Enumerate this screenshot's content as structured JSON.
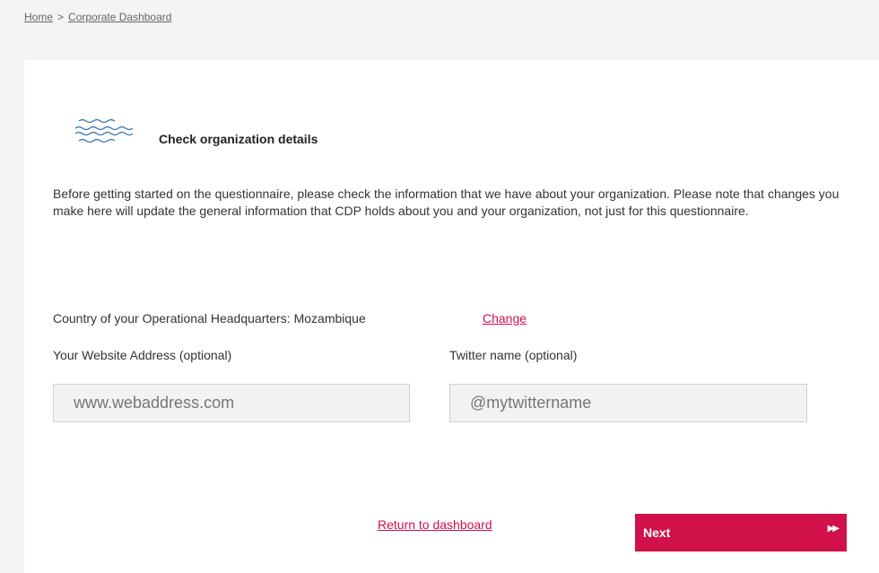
{
  "breadcrumb": {
    "home": "Home",
    "separator": ">",
    "current": "Corporate Dashboard"
  },
  "section": {
    "icon": "waves-icon",
    "title": "Check organization details",
    "intro": "Before getting started on the questionnaire, please check the information that we have about your organization. Please note that changes you make here will update the general information that CDP holds about you and your organization, not just for this questionnaire."
  },
  "country": {
    "label": "Country of your Operational Headquarters:",
    "value": "Mozambique",
    "change_link": "Change"
  },
  "website": {
    "label": "Your Website Address (optional)",
    "placeholder": "www.webaddress.com",
    "value": ""
  },
  "twitter": {
    "label": "Twitter name (optional)",
    "placeholder": "@mytwittername",
    "value": ""
  },
  "actions": {
    "return_link": "Return to dashboard",
    "next_label": "Next",
    "next_icon": "fast-forward-icon"
  },
  "colors": {
    "accent": "#d0114a",
    "icon_blue": "#2f6fb5",
    "background": "#f4f4f4",
    "card": "#ffffff",
    "input_bg": "#f2f2f2"
  }
}
